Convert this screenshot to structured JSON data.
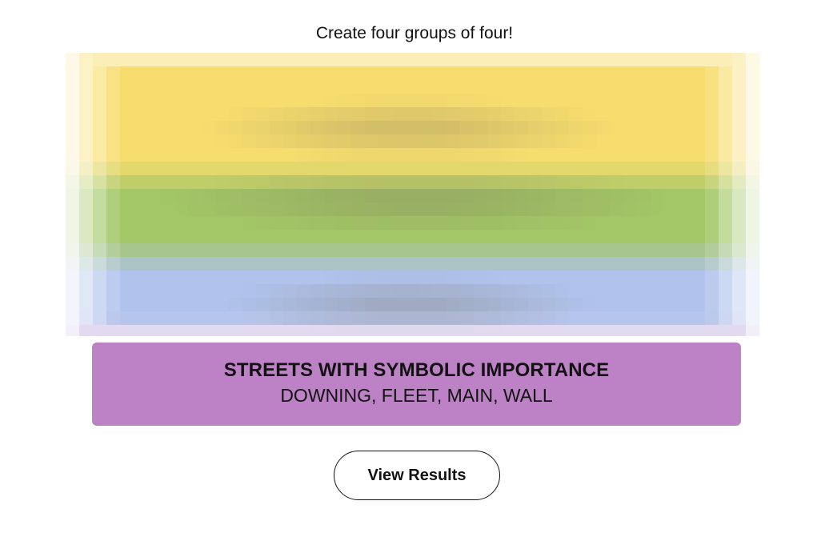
{
  "game": {
    "instruction": "Create four groups of four!"
  },
  "blurred_groups": {
    "colors": [
      "#f7dd6e",
      "#a3c766",
      "#b0c3ec",
      "#bd80c4"
    ]
  },
  "solved_group": {
    "title": "STREETS WITH SYMBOLIC IMPORTANCE",
    "words": "DOWNING, FLEET, MAIN, WALL",
    "color": "#bc82c5"
  },
  "actions": {
    "view_results_label": "View Results"
  }
}
